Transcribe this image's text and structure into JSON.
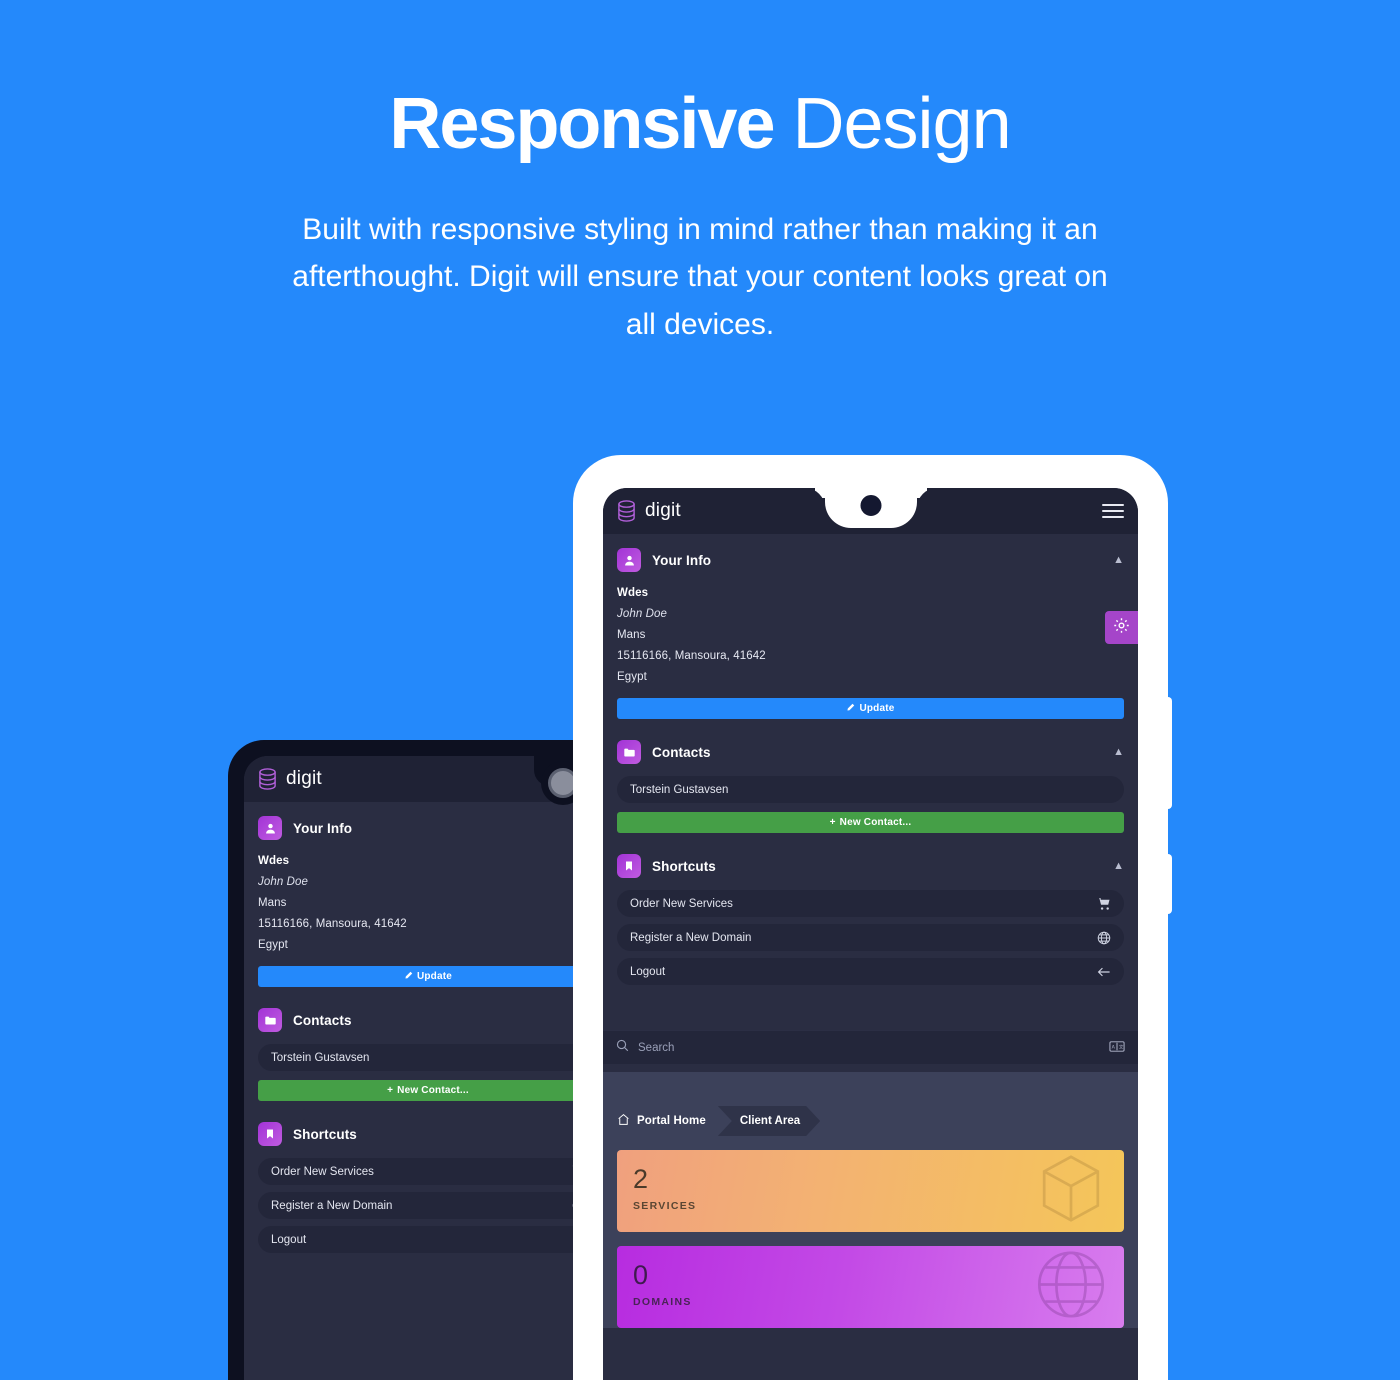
{
  "hero": {
    "title_bold": "Responsive",
    "title_light": " Design",
    "subtitle": "Built with responsive styling in mind rather than making it an afterthought. Digit will ensure that your content looks great on all devices."
  },
  "colors": {
    "background": "#2489fb",
    "sidebar": "#2a2d42",
    "topbar": "#1f2235",
    "item": "#23263a",
    "content": "#3c415a",
    "accent_purple": "#a545c9",
    "primary_blue": "#2489fb",
    "green": "#459f47"
  },
  "app": {
    "brand": {
      "name": "digit",
      "logo_icon": "database-icon"
    },
    "menu_icon": "hamburger-menu-icon",
    "gear_tab_icon": "gear-icon",
    "sections": [
      {
        "id": "your-info",
        "title": "Your Info",
        "icon": "user-icon",
        "collapse_icon": "chevron-up-icon",
        "lines": [
          "Wdes",
          "John Doe",
          "Mans",
          "15116166, Mansoura, 41642",
          "Egypt"
        ],
        "button": {
          "label": "Update",
          "icon": "pencil-icon"
        }
      },
      {
        "id": "contacts",
        "title": "Contacts",
        "icon": "folder-icon",
        "collapse_icon": "chevron-up-icon",
        "items": [
          {
            "label": "Torstein Gustavsen"
          }
        ],
        "button": {
          "label": "New Contact...",
          "icon": "plus-icon"
        }
      },
      {
        "id": "shortcuts",
        "title": "Shortcuts",
        "icon": "bookmark-icon",
        "collapse_icon": "chevron-up-icon",
        "items": [
          {
            "label": "Order New Services",
            "icon": "shopping-cart-icon"
          },
          {
            "label": "Register a New Domain",
            "icon": "globe-icon"
          },
          {
            "label": "Logout",
            "icon": "arrow-left-icon"
          }
        ]
      }
    ],
    "search": {
      "placeholder": "Search",
      "icon": "search-icon",
      "right_icon": "keyboard-icon"
    },
    "breadcrumb": {
      "home_icon": "home-icon",
      "home_label": "Portal Home",
      "current_label": "Client Area"
    },
    "stats": [
      {
        "value": "2",
        "label": "SERVICES",
        "icon": "cube-icon"
      },
      {
        "value": "0",
        "label": "DOMAINS",
        "icon": "globe-icon"
      }
    ]
  }
}
